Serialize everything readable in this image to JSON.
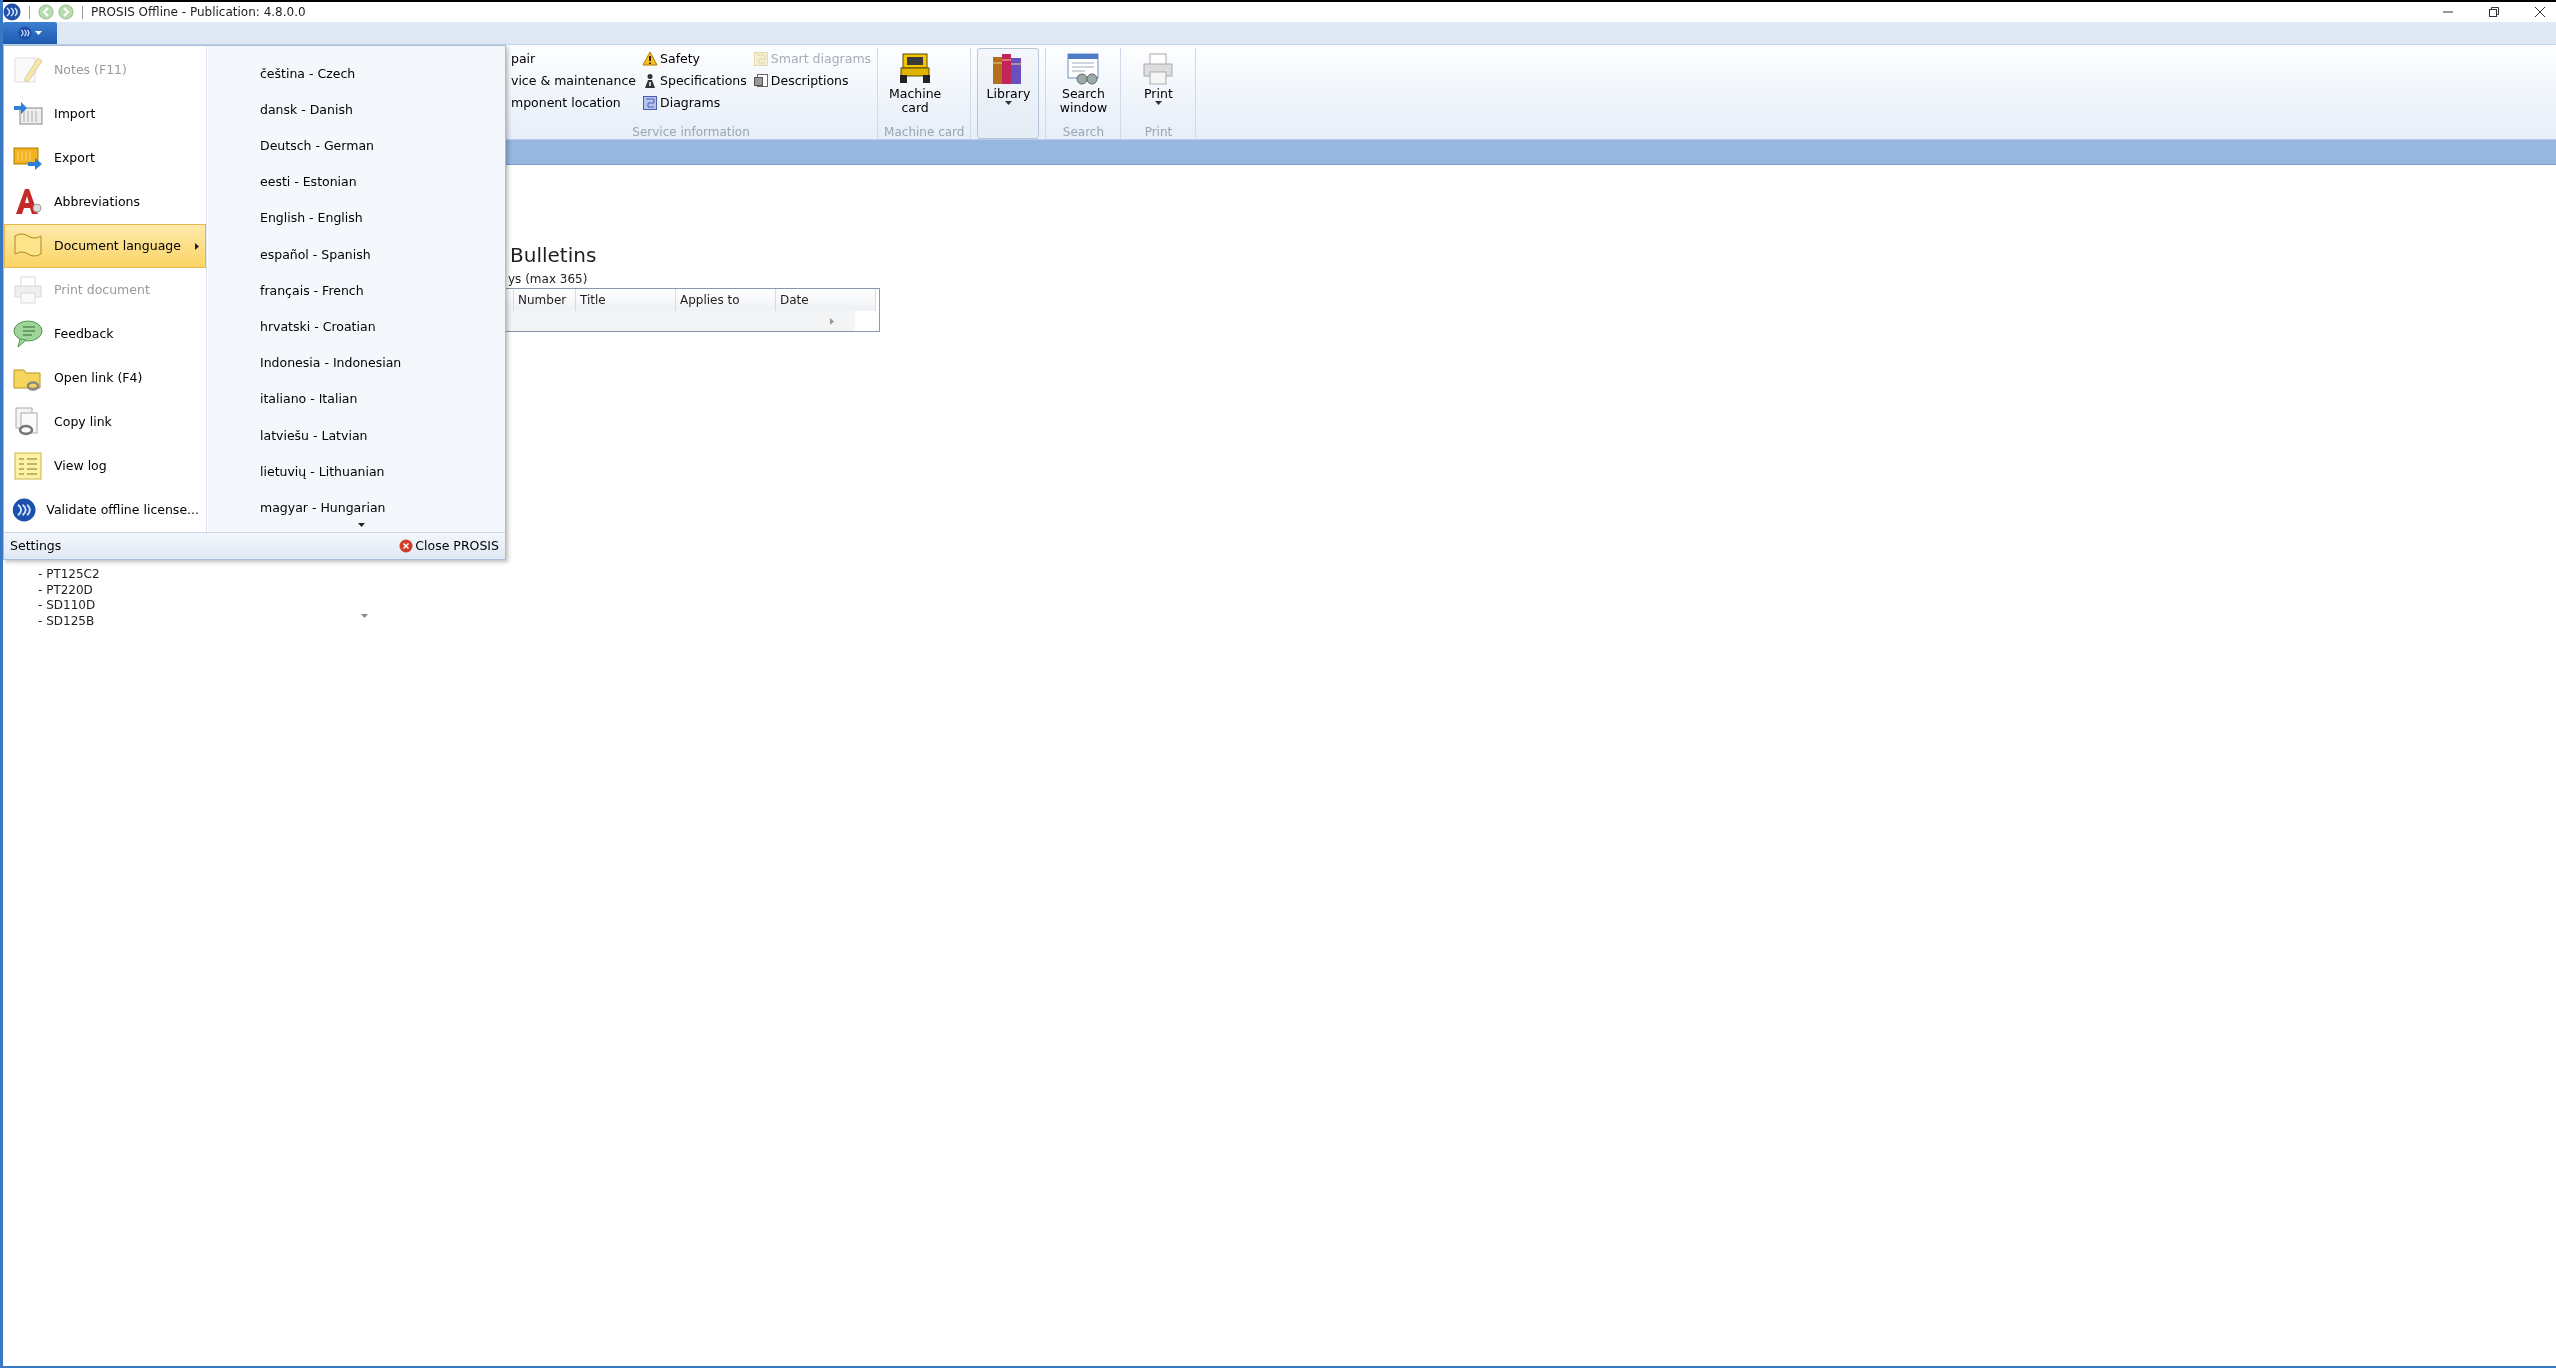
{
  "window": {
    "title": "PROSIS Offline - Publication: 4.8.0.0"
  },
  "ribbon": {
    "groups": [
      {
        "label": "Service information",
        "small_items": [
          {
            "label": "pair",
            "disabled": false
          },
          {
            "label": "vice & maintenance",
            "disabled": false
          },
          {
            "label": "mponent location",
            "disabled": false
          },
          {
            "label": "Safety",
            "disabled": false
          },
          {
            "label": "Specifications",
            "disabled": false
          },
          {
            "label": "Diagrams",
            "disabled": false
          },
          {
            "label": "Smart diagrams",
            "disabled": true
          },
          {
            "label": "Descriptions",
            "disabled": false
          }
        ]
      },
      {
        "label": "Machine card",
        "large_items": [
          {
            "label": "Machine card",
            "dropdown": false,
            "pressed": false
          }
        ]
      },
      {
        "large_items": [
          {
            "label": "Library",
            "dropdown": true,
            "pressed": true
          }
        ]
      },
      {
        "label": "Search",
        "large_items": [
          {
            "label": "Search window",
            "dropdown": false,
            "pressed": false
          }
        ]
      },
      {
        "label": "Print",
        "large_items": [
          {
            "label": "Print",
            "dropdown": true,
            "pressed": false
          }
        ]
      }
    ]
  },
  "bulletins": {
    "title": "Bulletins",
    "subtitle": "ys (max 365)",
    "columns": [
      "Number",
      "Title",
      "Applies to",
      "Date"
    ]
  },
  "tree": {
    "items": [
      "- PT125C2",
      "- PT220D",
      "- SD110D",
      "- SD125B"
    ]
  },
  "app_menu": {
    "items": [
      {
        "label": "Notes (F11)",
        "disabled": true,
        "selected": false,
        "submenu": false
      },
      {
        "label": "Import",
        "disabled": false,
        "selected": false,
        "submenu": false
      },
      {
        "label": "Export",
        "disabled": false,
        "selected": false,
        "submenu": false
      },
      {
        "label": "Abbreviations",
        "disabled": false,
        "selected": false,
        "submenu": false
      },
      {
        "label": "Document language",
        "disabled": false,
        "selected": true,
        "submenu": true
      },
      {
        "label": "Print document",
        "disabled": true,
        "selected": false,
        "submenu": false
      },
      {
        "label": "Feedback",
        "disabled": false,
        "selected": false,
        "submenu": false
      },
      {
        "label": "Open link (F4)",
        "disabled": false,
        "selected": false,
        "submenu": false
      },
      {
        "label": "Copy link",
        "disabled": false,
        "selected": false,
        "submenu": false
      },
      {
        "label": "View log",
        "disabled": false,
        "selected": false,
        "submenu": false
      },
      {
        "label": "Validate offline license...",
        "disabled": false,
        "selected": false,
        "submenu": false
      }
    ],
    "languages": [
      "čeština - Czech",
      "dansk - Danish",
      "Deutsch - German",
      "eesti - Estonian",
      "English - English",
      "español - Spanish",
      "français - French",
      "hrvatski - Croatian",
      "Indonesia - Indonesian",
      "italiano - Italian",
      "latviešu - Latvian",
      "lietuvių - Lithuanian",
      "magyar - Hungarian"
    ],
    "settings": "Settings",
    "close": "Close PROSIS"
  }
}
